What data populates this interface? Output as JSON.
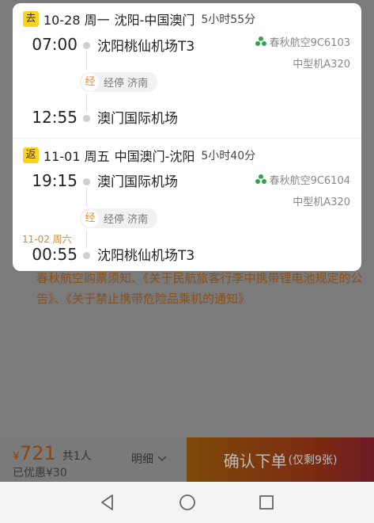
{
  "background": {
    "notice_text": "春秋航空购票须知、《关于民航旅客行李中携带锂电池规定的公告》、《关于禁止携带危险品乘机的通知》"
  },
  "segments": [
    {
      "tag": "去",
      "date": "10-28 周一",
      "route": "沈阳-中国澳门",
      "duration": "5小时55分",
      "depart_time": "07:00",
      "depart_airport": "沈阳桃仙机场T3",
      "stop_badge": "经",
      "stop_text": "经停 济南",
      "arrive_time": "12:55",
      "arrive_airport": "澳门国际机场",
      "arrive_date_note": "",
      "airline": "春秋航空9C6103",
      "aircraft": "中型机A320"
    },
    {
      "tag": "返",
      "date": "11-01 周五",
      "route": "中国澳门-沈阳",
      "duration": "5小时40分",
      "depart_time": "19:15",
      "depart_airport": "澳门国际机场",
      "stop_badge": "经",
      "stop_text": "经停 济南",
      "arrive_time": "00:55",
      "arrive_airport": "沈阳桃仙机场T3",
      "arrive_date_note": "11-02 周六",
      "airline": "春秋航空9C6104",
      "aircraft": "中型机A320"
    }
  ],
  "order_bar": {
    "currency": "¥",
    "price": "721",
    "passengers": "共1人",
    "discount": "已优惠¥30",
    "detail_label": "明细",
    "confirm_label": "确认下单",
    "remaining_label": "(仅剩9张)"
  },
  "colors": {
    "tag_yellow": "#ffd21f",
    "next_day_orange": "#c8893e",
    "airline_green": "#2fa34a"
  },
  "icons": {
    "airline_logo": "spring-airlines-logo-icon",
    "detail_chevron": "chevron-down-icon",
    "nav_back": "back-triangle-icon",
    "nav_home": "home-circle-icon",
    "nav_recent": "recent-square-icon"
  }
}
